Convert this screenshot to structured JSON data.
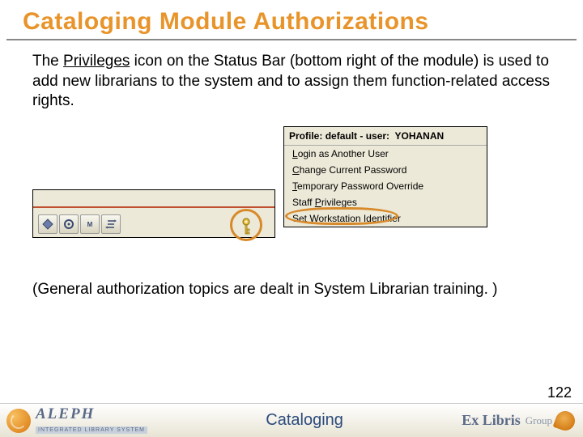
{
  "title": "Cataloging Module Authorizations",
  "intro": {
    "prefix": "The ",
    "underlined": "Privileges",
    "rest": " icon on the Status Bar (bottom right of the module) is used to add new librarians to the system and to assign them function-related access rights."
  },
  "statusbar": {
    "icons": [
      "direction-icon",
      "gear-icon",
      "marc-icon",
      "reorder-icon"
    ],
    "highlighted_icon": "key-icon"
  },
  "menu": {
    "header_profile_label": "Profile:",
    "header_profile_value": "default",
    "header_user_label": "user:",
    "header_user_value": "YOHANAN",
    "items": [
      {
        "text": "Login as Another User",
        "ul_first": true
      },
      {
        "text": "Change Current Password",
        "ul_first": true
      },
      {
        "text": "Temporary Password Override",
        "ul_first": true
      },
      {
        "text": "Staff Privileges",
        "ul_first": false,
        "highlight": true
      },
      {
        "text": "Set Workstation Identifier",
        "ul_first": false
      }
    ]
  },
  "lower_note": "(General authorization topics are dealt in System Librarian training. )",
  "page_number": "122",
  "footer": {
    "aleph": "ALEPH",
    "aleph_sub": "INTEGRATED LIBRARY SYSTEM",
    "center": "Cataloging",
    "exlibris_main": "Ex Libris",
    "exlibris_sub": "Group"
  }
}
